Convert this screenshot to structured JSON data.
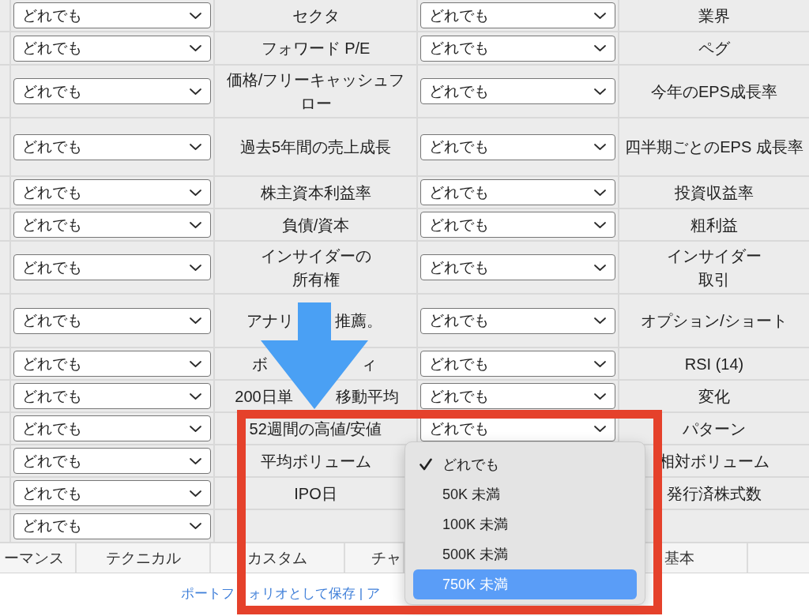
{
  "filters": [
    {
      "left": {
        "value": "どれでも",
        "expanded": false
      },
      "left_label": "セクタ",
      "right": {
        "value": "どれでも",
        "expanded": false
      },
      "right_label": "業界"
    },
    {
      "left": {
        "value": "どれでも",
        "expanded": false
      },
      "left_label": "フォワード P/E",
      "right": {
        "value": "どれでも",
        "expanded": false
      },
      "right_label": "ペグ"
    },
    {
      "left": {
        "value": "どれでも",
        "expanded": false
      },
      "left_label": "価格/フリーキャッシュフロー",
      "right": {
        "value": "どれでも",
        "expanded": false
      },
      "right_label": "今年のEPS成長率"
    },
    {
      "left": {
        "value": "どれでも",
        "expanded": false
      },
      "left_label": "過去5年間の売上成長",
      "right": {
        "value": "どれでも",
        "expanded": false
      },
      "right_label": "四半期ごとのEPS 成長率"
    },
    {
      "left": {
        "value": "どれでも",
        "expanded": false
      },
      "left_label": "株主資本利益率",
      "right": {
        "value": "どれでも",
        "expanded": false
      },
      "right_label": "投資収益率"
    },
    {
      "left": {
        "value": "どれでも",
        "expanded": false
      },
      "left_label": "負債/資本",
      "right": {
        "value": "どれでも",
        "expanded": false
      },
      "right_label": "粗利益"
    },
    {
      "left": {
        "value": "どれでも",
        "expanded": false
      },
      "left_label": "インサイダーの所有権",
      "right": {
        "value": "どれでも",
        "expanded": false
      },
      "right_label": "インサイダー取引"
    },
    {
      "left": {
        "value": "どれでも",
        "expanded": false
      },
      "left_label_parts": [
        "アナリ",
        "推薦。"
      ],
      "right": {
        "value": "どれでも",
        "expanded": false
      },
      "right_label": "オプション/ショート"
    },
    {
      "left": {
        "value": "どれでも",
        "expanded": false
      },
      "left_label_parts": [
        "ボ",
        "ィ"
      ],
      "right": {
        "value": "どれでも",
        "expanded": false
      },
      "right_label": "RSI (14)"
    },
    {
      "left": {
        "value": "どれでも",
        "expanded": false
      },
      "left_label_parts": [
        "200日単",
        "移動平均"
      ],
      "right": {
        "value": "どれでも",
        "expanded": false
      },
      "right_label": "変化"
    },
    {
      "left": {
        "value": "どれでも",
        "expanded": false
      },
      "left_label": "52週間の高値/安値",
      "right": {
        "value": "どれでも",
        "expanded": false
      },
      "right_label": "パターン"
    },
    {
      "left": {
        "value": "どれでも",
        "expanded": false
      },
      "left_label": "平均ボリューム",
      "right": {
        "expanded": true,
        "options": [
          {
            "label": "どれでも",
            "selected": true,
            "highlighted": false
          },
          {
            "label": "50K 未満",
            "selected": false,
            "highlighted": false
          },
          {
            "label": "100K 未満",
            "selected": false,
            "highlighted": false
          },
          {
            "label": "500K 未満",
            "selected": false,
            "highlighted": false
          },
          {
            "label": "750K 未満",
            "selected": false,
            "highlighted": true
          }
        ]
      },
      "right_label": "相対ボリューム"
    },
    {
      "left": {
        "value": "どれでも",
        "expanded": false
      },
      "left_label": "IPO日",
      "right_label": "発行済株式数"
    },
    {
      "left": {
        "value": "どれでも",
        "expanded": false
      }
    }
  ],
  "tabs": [
    {
      "label": "ーマンス"
    },
    {
      "label": "テクニカル"
    },
    {
      "label": "カスタム"
    },
    {
      "label": "チャ"
    },
    {
      "label": "基本"
    }
  ],
  "footer": {
    "link_parts": [
      "ポートフ",
      "ォリオとして保存 | ア"
    ]
  }
}
